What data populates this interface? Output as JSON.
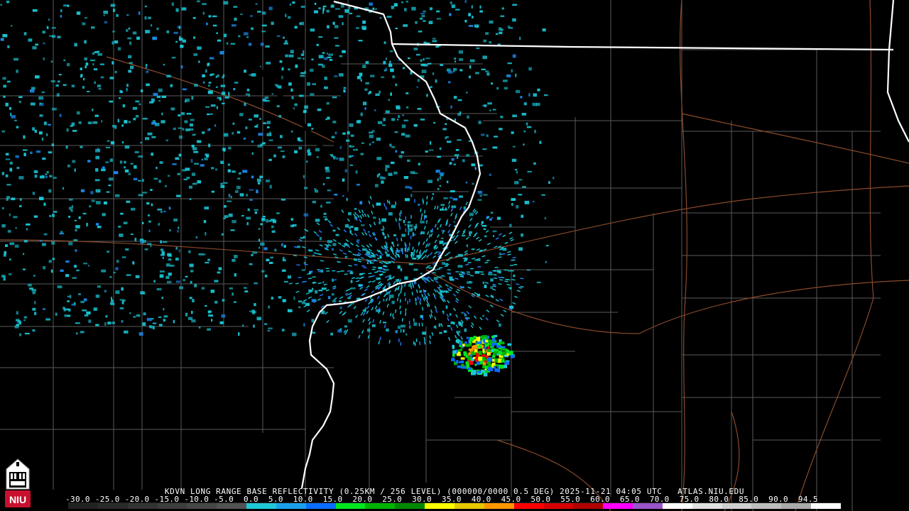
{
  "product_header": "KDVN LONG RANGE BASE REFLECTIVITY (0.25KM / 256 LEVEL) (000000/0000 0.5 DEG) 2025-11-21 04:05 UTC   ATLAS.NIU.EDU",
  "scale_labels": "-30.0 -25.0 -20.0 -15.0 -10.0 -5.0  0.0  5.0  10.0  15.0  20.0  25.0  30.0  35.0  40.0  45.0  50.0  55.0  60.0  65.0  70.0  75.0  80.0  85.0  90.0  94.5",
  "logo_text": "NIU",
  "colors": {
    "background": "#000000",
    "county_lines": "#5a5a5a",
    "state_lines": "#ffffff",
    "highways": "#8a4a2a",
    "clutter": "#19c6d6",
    "logo_red": "#c8102e"
  },
  "color_scale": [
    "#222222",
    "#2a2a2a",
    "#333333",
    "#3d3d3d",
    "#474747",
    "#525252",
    "#1ec8d6",
    "#1aa0ea",
    "#0a6cff",
    "#00e61e",
    "#00b400",
    "#008800",
    "#ffff00",
    "#e6c800",
    "#ff9600",
    "#ff0000",
    "#d60000",
    "#b00000",
    "#ff00ff",
    "#9955c9",
    "#ffffff",
    "#e0e0e0",
    "#cfcfcf",
    "#bdbdbd",
    "#aaaaaa",
    "#ffffff"
  ]
}
